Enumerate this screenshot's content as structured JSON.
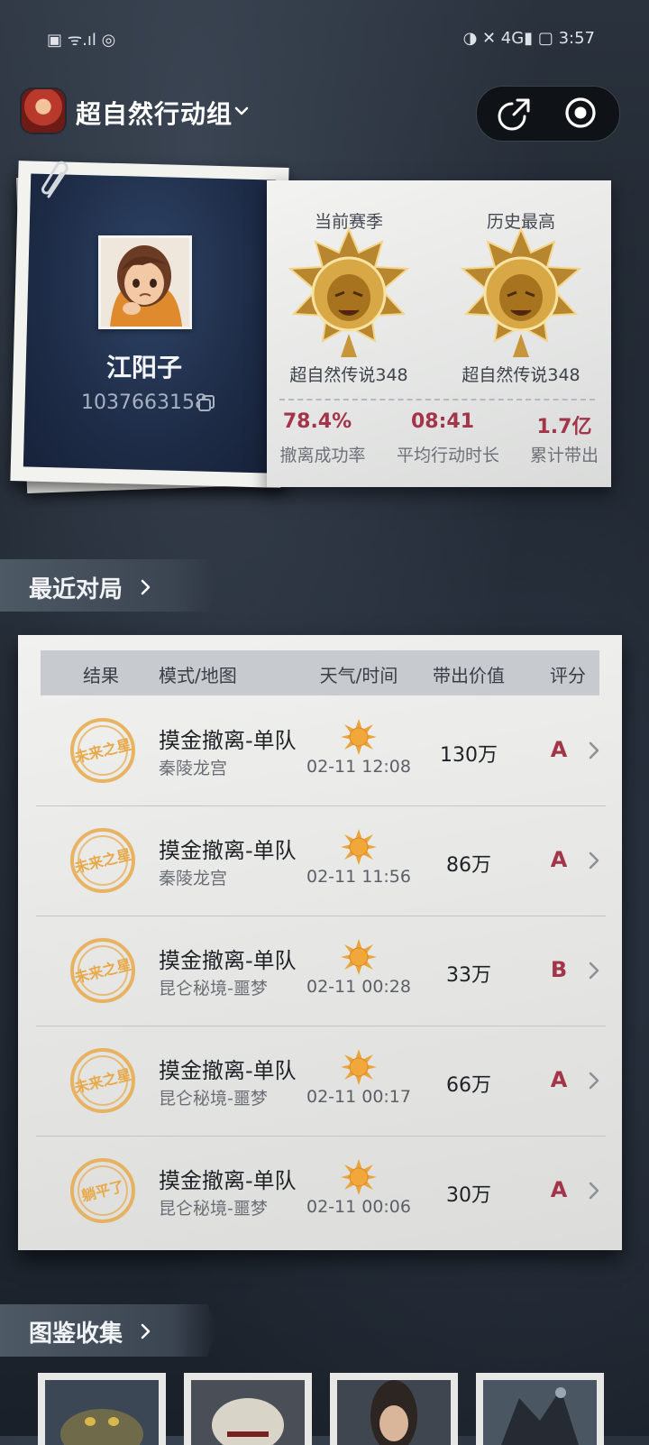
{
  "status_bar": {
    "left": "▣ ᯤ.ıl ◎",
    "right": "◑ ✕ 4G▮ ▢ 3:57"
  },
  "header": {
    "title": "超自然行动组"
  },
  "profile": {
    "name": "江阳子",
    "id": "1037663158"
  },
  "stats": {
    "current_season_label": "当前赛季",
    "history_best_label": "历史最高",
    "current_rank": "超自然传说348",
    "best_rank": "超自然传说348",
    "success_rate": "78.4%",
    "success_rate_label": "撤离成功率",
    "avg_time": "08:41",
    "avg_time_label": "平均行动时长",
    "total_loot": "1.7亿",
    "total_loot_label": "累计带出"
  },
  "recent": {
    "title": "最近对局",
    "headers": {
      "result": "结果",
      "mode": "模式/地图",
      "weather": "天气/时间",
      "value": "带出价值",
      "grade": "评分"
    },
    "rows": [
      {
        "stamp": "未来之星",
        "mode": "摸金撤离-单队",
        "map": "秦陵龙宫",
        "time": "02-11 12:08",
        "value": "130万",
        "grade": "A"
      },
      {
        "stamp": "未来之星",
        "mode": "摸金撤离-单队",
        "map": "秦陵龙宫",
        "time": "02-11 11:56",
        "value": "86万",
        "grade": "A"
      },
      {
        "stamp": "未来之星",
        "mode": "摸金撤离-单队",
        "map": "昆仑秘境-噩梦",
        "time": "02-11 00:28",
        "value": "33万",
        "grade": "B"
      },
      {
        "stamp": "未来之星",
        "mode": "摸金撤离-单队",
        "map": "昆仑秘境-噩梦",
        "time": "02-11 00:17",
        "value": "66万",
        "grade": "A"
      },
      {
        "stamp": "躺平了",
        "mode": "摸金撤离-单队",
        "map": "昆仑秘境-噩梦",
        "time": "02-11 00:06",
        "value": "30万",
        "grade": "A"
      }
    ]
  },
  "collection": {
    "title": "图鉴收集"
  },
  "colors": {
    "accent_red": "#a3354a",
    "stamp_gold": "#e7a94a",
    "gold": "#d8a84a"
  }
}
